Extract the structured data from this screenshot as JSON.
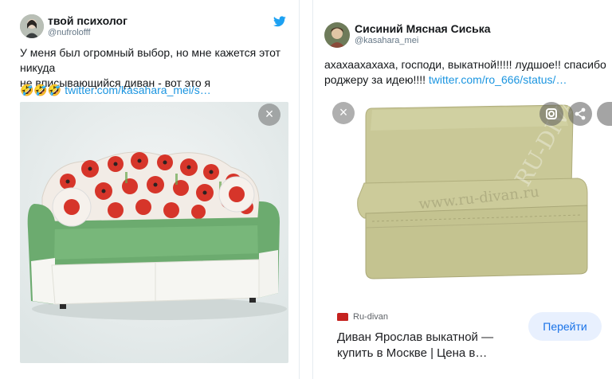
{
  "left_tweet": {
    "author_name": "твой психолог",
    "author_handle": "@nufrolofff",
    "text_line1": "У меня был огромный выбор, но мне кажется этот никуда",
    "text_line2": "не вписывающийся диван - вот это я",
    "emoji": "🤣🤣🤣",
    "link_text": "twitter.com/kasahara_mei/s…",
    "close_icon": "×",
    "bird_icon": "twitter-bird-icon"
  },
  "right_tweet": {
    "author_name": "Сисиний Мясная Сиська",
    "author_handle": "@kasahara_mei",
    "text_line1": "ахахаахахаха, господи, выкатной!!!!! лудшое!! спасибо",
    "text_line2_prefix": "роджеру за идею!!!! ",
    "link_text": "twitter.com/ro_666/status/…",
    "close_icon": "×",
    "watermark": "www.ru-divan.ru",
    "source_name": "Ru-divan",
    "product_title_line1": "Диван Ярослав выкатной —",
    "product_title_line2": "купить в Москве | Цена в…",
    "go_button_label": "Перейти"
  },
  "colors": {
    "link": "#1b95e0",
    "twitter_blue": "#1da1f2",
    "google_button_bg": "#e8f0fe",
    "google_button_text": "#1a73e8",
    "sofa_green": "#6cab6f",
    "sofa_beige": "#c9c897",
    "poppy_red": "#d6352a"
  }
}
